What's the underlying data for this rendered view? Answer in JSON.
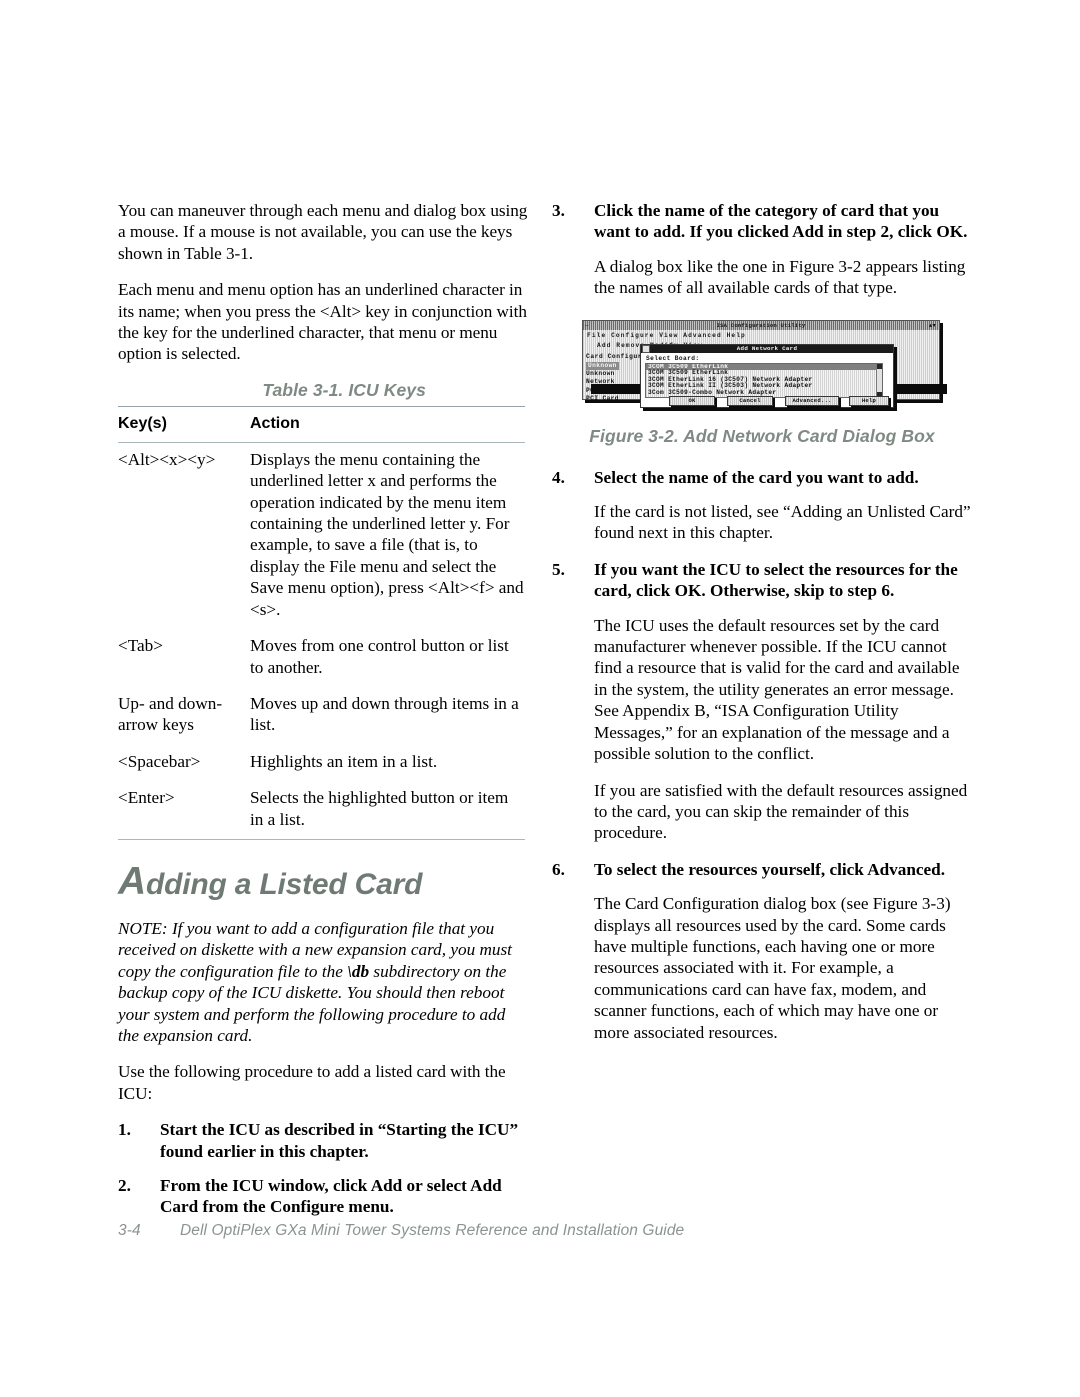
{
  "page": {
    "footer_page_number": "3-4",
    "footer_title": "Dell OptiPlex GXa Mini Tower Systems Reference and Installation Guide"
  },
  "left_column": {
    "intro_paragraph_1": "You can maneuver through each menu and dialog box using a mouse. If a mouse is not available, you can use the keys shown in Table 3-1.",
    "intro_paragraph_2": "Each menu and menu option has an underlined character in its name; when you press the <Alt> key in conjunction with the key for the underlined character, that menu or menu option is selected.",
    "table": {
      "caption": "Table 3-1.  ICU Keys",
      "headers": [
        "Key(s)",
        "Action"
      ],
      "rows": [
        {
          "key": "<Alt><x><y>",
          "action": "Displays the menu containing the underlined letter x and performs the operation indicated by the menu item containing the underlined letter y. For example, to save a file (that is, to display the File menu and select the Save menu option), press <Alt><f> and <s>."
        },
        {
          "key": "<Tab>",
          "action": "Moves from one control button or list to another."
        },
        {
          "key": "Up- and down-arrow keys",
          "action": "Moves up and down through items in a list."
        },
        {
          "key": "<Spacebar>",
          "action": "Highlights an item in a list."
        },
        {
          "key": "<Enter>",
          "action": "Selects the highlighted button or item in a list."
        }
      ]
    },
    "section_heading_first_letter": "A",
    "section_heading_rest": "dding a Listed Card",
    "note_text_1": "NOTE: If you want to add a configuration file that you received on diskette with a new expansion card, you must copy the configuration file to the ",
    "note_bold": "\\db",
    "note_text_2": " subdirectory on the backup copy of the ICU diskette. You should then reboot your system and perform the following procedure to add the expansion card.",
    "procedure_intro": "Use the following procedure to add a listed card with the ICU:",
    "steps": [
      {
        "number": "1.",
        "heading": "Start the ICU as described in “Starting the ICU” found earlier in this chapter."
      },
      {
        "number": "2.",
        "heading": "From the ICU window, click Add or select Add Card from the Configure menu."
      }
    ]
  },
  "right_column": {
    "steps": [
      {
        "number": "3.",
        "heading": "Click the name of the category of card that you want to add. If you clicked Add in step 2, click OK.",
        "body": "A dialog box like the one in Figure 3-2 appears listing the names of all available cards of that type."
      },
      {
        "number": "4.",
        "heading": "Select the name of the card you want to add.",
        "body": "If the card is not listed, see “Adding an Unlisted Card” found next in this chapter."
      },
      {
        "number": "5.",
        "heading": "If you want the ICU to select the resources for the card, click OK. Otherwise, skip to step 6.",
        "body": "The ICU uses the default resources set by the card manufacturer whenever possible. If the ICU cannot find a resource that is valid for the card and available in the system, the utility generates an error message. See Appendix B, “ISA Configuration Utility Messages,” for an explanation of the message and a possible solution to the conflict.",
        "body2": "If you are satisfied with the default resources assigned to the card, you can skip the remainder of this procedure."
      },
      {
        "number": "6.",
        "heading": "To select the resources yourself, click Advanced.",
        "body": "The Card Configuration dialog box (see Figure 3-3) displays all resources used by the card. Some cards have multiple functions, each having one or more resources associated with it. For example, a communications card can have fax, modem, and scanner functions, each of which may have one or more associated resources."
      }
    ],
    "figure": {
      "caption": "Figure 3-2.  Add Network Card Dialog Box",
      "screenshot": {
        "window_title": "ISA Configuration Utility",
        "title_left": "─",
        "title_right": "▲▼",
        "menu_bar": "File  Configure  View  Advanced  Help",
        "tool_bar": "Add        Remove     Modify      View",
        "card_config_label": "Card Configuration",
        "background_list": [
          "Unknown",
          "Unknown",
          "Network",
          "PCI Card",
          "PCI Card"
        ],
        "dialog_title": "Add Network Card",
        "dialog_list_label": "Select Board:",
        "dialog_list_items": [
          "3COM 3C509 EtherLink",
          "3COM 3C509 EtherLink",
          "3COM EtherLink 16 (3C507) Network Adapter",
          "3COM EtherLink II (3C503) Network Adapter",
          "3Com 3C509-Combo Network Adapter"
        ],
        "dialog_selected_index": 0,
        "buttons": [
          "OK",
          "Cancel",
          "Advanced...",
          "Help"
        ]
      }
    }
  },
  "colors": {
    "heading": "#6f7a74",
    "caption": "#808a84",
    "rule": "#93a3a8",
    "footer": "#8b948f",
    "text": "#000000"
  }
}
